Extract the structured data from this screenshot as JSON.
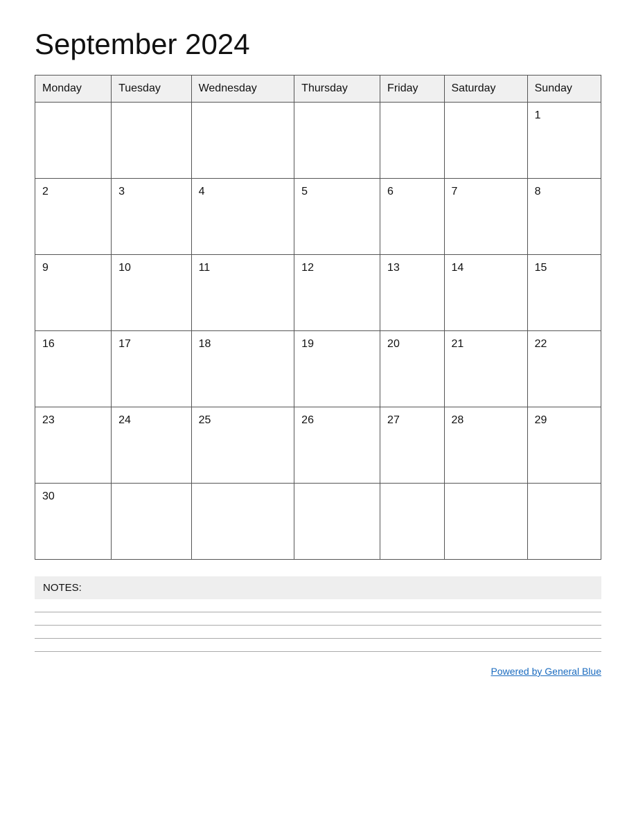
{
  "header": {
    "title": "September 2024"
  },
  "calendar": {
    "days_of_week": [
      "Monday",
      "Tuesday",
      "Wednesday",
      "Thursday",
      "Friday",
      "Saturday",
      "Sunday"
    ],
    "weeks": [
      [
        "",
        "",
        "",
        "",
        "",
        "",
        "1"
      ],
      [
        "2",
        "3",
        "4",
        "5",
        "6",
        "7",
        "8"
      ],
      [
        "9",
        "10",
        "11",
        "12",
        "13",
        "14",
        "15"
      ],
      [
        "16",
        "17",
        "18",
        "19",
        "20",
        "21",
        "22"
      ],
      [
        "23",
        "24",
        "25",
        "26",
        "27",
        "28",
        "29"
      ],
      [
        "30",
        "",
        "",
        "",
        "",
        "",
        ""
      ]
    ]
  },
  "notes": {
    "label": "NOTES:"
  },
  "footer": {
    "link_text": "Powered by General Blue",
    "link_url": "#"
  }
}
